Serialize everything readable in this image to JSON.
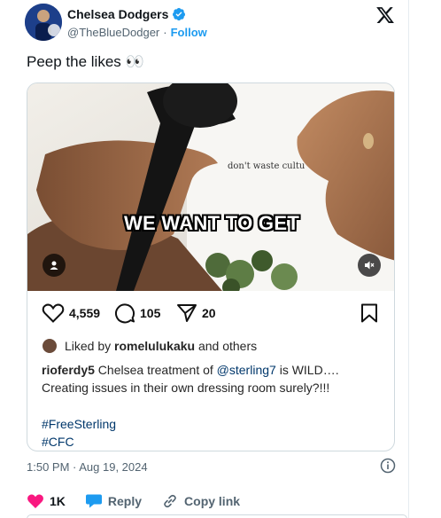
{
  "account": {
    "display_name": "Chelsea Dodgers",
    "handle": "@TheBlueDodger",
    "separator": "·",
    "follow_label": "Follow"
  },
  "tweet": {
    "text": "Peep the likes 👀",
    "timestamp": "1:50 PM · Aug 19, 2024"
  },
  "embed": {
    "video": {
      "shirt_text": "don't waste cultu",
      "caption": "WE WANT TO GET"
    },
    "actions": {
      "likes": "4,559",
      "comments": "105",
      "shares": "20"
    },
    "liked_by": {
      "prefix": "Liked by",
      "user": "romelulukaku",
      "suffix": "and others"
    },
    "post": {
      "author": "rioferdy5",
      "text_before": " Chelsea treatment of ",
      "mention": "@sterling7",
      "text_after": " is WILD…. Creating issues in their own dressing room surely?!!!",
      "hashtags": [
        "#FreeSterling",
        "#CFC"
      ]
    }
  },
  "footer": {
    "like_count": "1K",
    "reply_label": "Reply",
    "copy_link_label": "Copy link"
  },
  "colors": {
    "accent": "#1d9bf0",
    "heart": "#f91880",
    "muted": "#536471"
  }
}
